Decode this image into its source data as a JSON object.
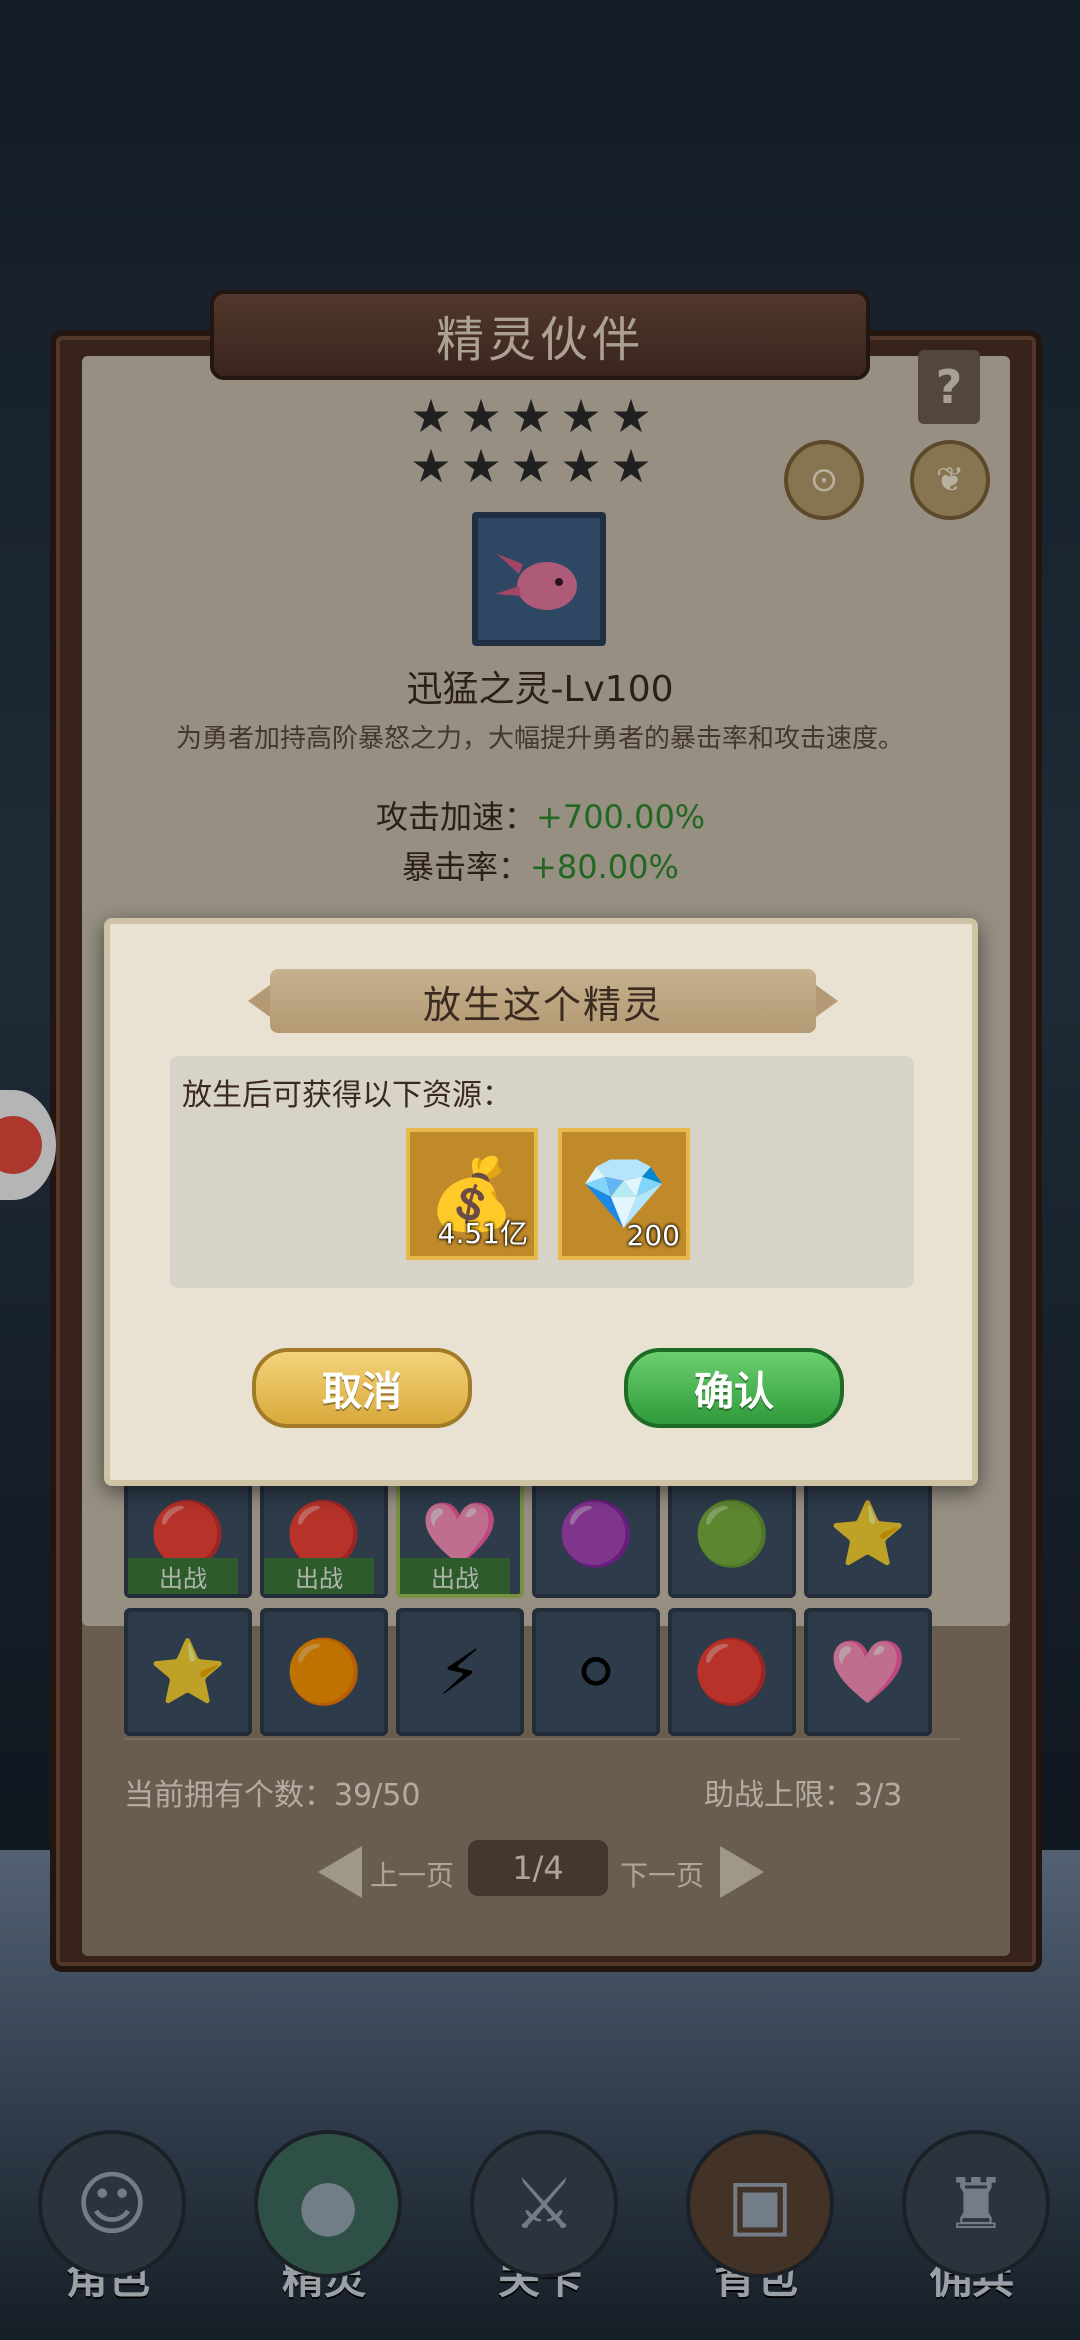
{
  "panel": {
    "title": "精灵伙伴",
    "help_label": "?",
    "stars_row1": [
      "★",
      "★",
      "★",
      "★",
      "★"
    ],
    "stars_row2": [
      "★",
      "★",
      "★",
      "★",
      "★"
    ],
    "pet_name": "迅猛之灵-Lv100",
    "pet_desc": "为勇者加持高阶暴怒之力，大幅提升勇者的暴击率和攻击速度。",
    "stats": [
      {
        "label": "攻击加速：",
        "value": "+700.00%"
      },
      {
        "label": "暴击率：",
        "value": "+80.00%"
      }
    ],
    "deploy_label": "出战",
    "owned_count": "当前拥有个数：39/50",
    "assist_limit": "助战上限：3/3",
    "pager": {
      "prev": "上一页",
      "page": "1/4",
      "next": "下一页"
    }
  },
  "modal": {
    "title": "放生这个精灵",
    "caption": "放生后可获得以下资源：",
    "rewards": [
      {
        "icon": "gold-chest-icon",
        "amount": "4.51亿"
      },
      {
        "icon": "diamond-chest-icon",
        "amount": "200"
      }
    ],
    "cancel_label": "取消",
    "confirm_label": "确认"
  },
  "bottom_nav": [
    {
      "label": "角色",
      "icon": "hero-icon"
    },
    {
      "label": "精灵",
      "icon": "spirit-icon"
    },
    {
      "label": "关卡",
      "icon": "stage-icon"
    },
    {
      "label": "背包",
      "icon": "backpack-icon"
    },
    {
      "label": "佣兵",
      "icon": "mercenary-icon"
    }
  ],
  "colors": {
    "stat_value": "#2e8a2e",
    "confirm": "#2f9a3b",
    "cancel": "#d9a93c"
  }
}
